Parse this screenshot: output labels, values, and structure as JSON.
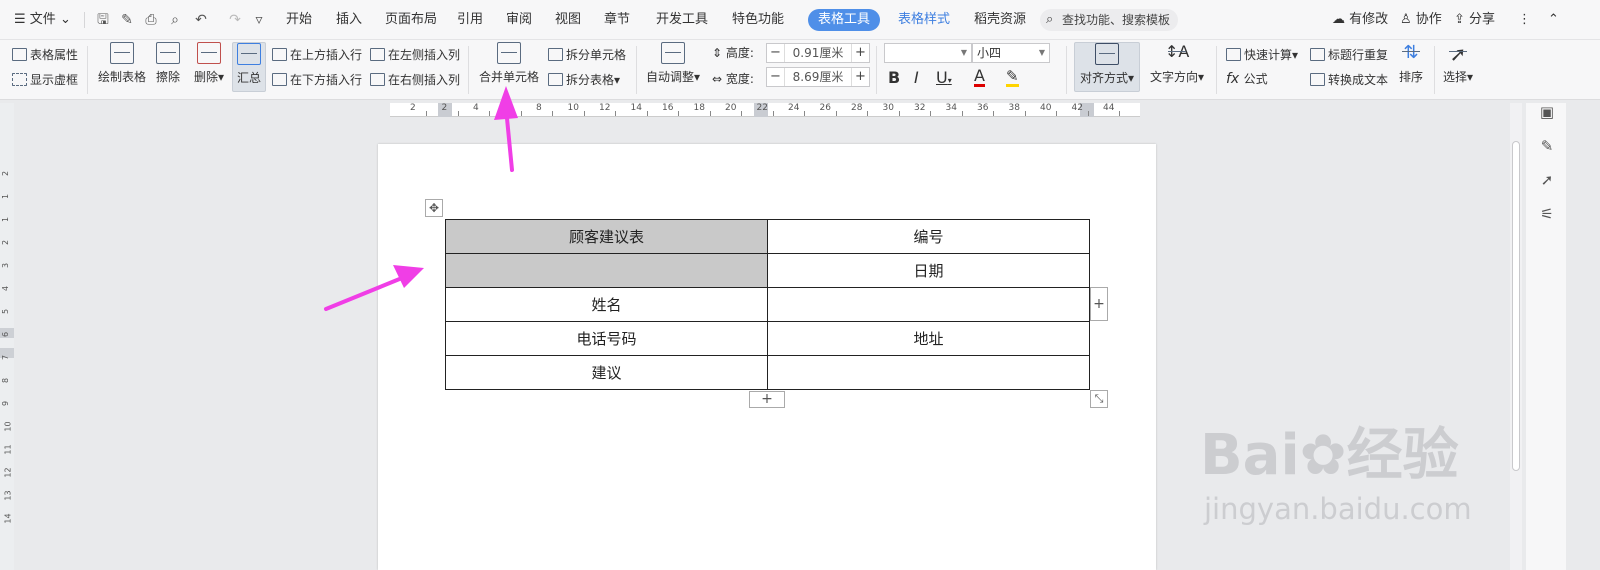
{
  "menubar": {
    "file": "文件",
    "tabs": [
      "开始",
      "插入",
      "页面布局",
      "引用",
      "审阅",
      "视图",
      "章节",
      "开发工具",
      "特色功能"
    ],
    "active_tab": "表格工具",
    "blue_tab": "表格样式",
    "extra_tab": "稻壳资源",
    "search": "查找功能、搜索模板",
    "right": {
      "modified": "有修改",
      "collab": "协作",
      "share": "分享"
    }
  },
  "ribbon": {
    "table_props": "表格属性",
    "show_gridlines": "显示虚框",
    "draw_table": "绘制表格",
    "erase": "擦除",
    "delete": "删除",
    "summary": "汇总",
    "insert_above": "在上方插入行",
    "insert_below": "在下方插入行",
    "insert_left": "在左侧插入列",
    "insert_right": "在右侧插入列",
    "merge_cells": "合并单元格",
    "split_cells": "拆分单元格",
    "split_table": "拆分表格",
    "auto_fit": "自动调整",
    "height_label": "高度:",
    "height_value": "0.91厘米",
    "width_label": "宽度:",
    "width_value": "8.69厘米",
    "font_size": "小四",
    "align": "对齐方式",
    "text_dir": "文字方向",
    "quick_calc": "快速计算",
    "formula": "公式",
    "repeat_header": "标题行重复",
    "to_text": "转换成文本",
    "sort": "排序",
    "select": "选择"
  },
  "ruler_numbers": [
    "2",
    "2",
    "4",
    "6",
    "8",
    "10",
    "12",
    "14",
    "16",
    "18",
    "20",
    "22",
    "24",
    "26",
    "28",
    "30",
    "32",
    "34",
    "36",
    "38",
    "40",
    "42",
    "44"
  ],
  "vruler_numbers": [
    "2",
    "1",
    "1",
    "2",
    "3",
    "4",
    "5",
    "6",
    "7",
    "8",
    "9",
    "10",
    "11",
    "12",
    "13",
    "14"
  ],
  "table": {
    "rows": [
      [
        "顾客建议表",
        "编号"
      ],
      [
        "",
        "日期"
      ],
      [
        "姓名",
        ""
      ],
      [
        "电话号码",
        "地址"
      ],
      [
        "建议",
        ""
      ]
    ]
  },
  "watermark": {
    "brand": "Bai",
    "cn": "经验",
    "url": "jingyan.baidu.com"
  },
  "colors": {
    "accent": "#4f8fe8",
    "arrow": "#f03ee6",
    "shade": "#c9c9c9"
  }
}
